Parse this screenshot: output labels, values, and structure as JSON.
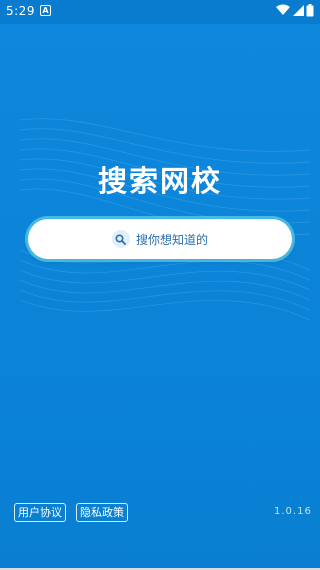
{
  "status_bar": {
    "time": "5:29",
    "notification_badge": "A",
    "icons": [
      "wifi-icon",
      "signal-icon",
      "battery-icon"
    ]
  },
  "app": {
    "title": "搜索网校"
  },
  "search": {
    "placeholder": "搜你想知道的",
    "icon": "search-icon"
  },
  "footer": {
    "user_agreement": "用户协议",
    "privacy_policy": "隐私政策",
    "version": "1.0.16"
  },
  "colors": {
    "background": "#0b84d8",
    "search_glow": "#78e6f0",
    "placeholder": "#2a6fb0",
    "text": "#ffffff"
  }
}
